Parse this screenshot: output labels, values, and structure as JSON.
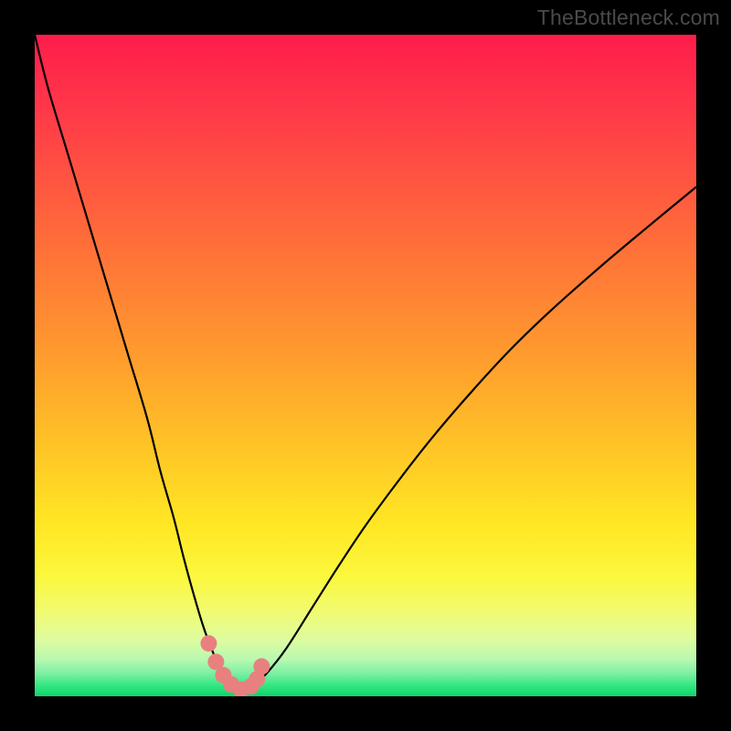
{
  "watermark": {
    "text": "TheBottleneck.com"
  },
  "colors": {
    "frame": "#000000",
    "curve": "#000000",
    "marker_fill": "#e98080",
    "marker_stroke": "#c95a5a",
    "gradient_stops": [
      {
        "offset": 0.0,
        "color": "#ff1c4b"
      },
      {
        "offset": 0.12,
        "color": "#ff3a49"
      },
      {
        "offset": 0.3,
        "color": "#ff6a3a"
      },
      {
        "offset": 0.48,
        "color": "#ff9a2e"
      },
      {
        "offset": 0.62,
        "color": "#ffc326"
      },
      {
        "offset": 0.74,
        "color": "#ffe724"
      },
      {
        "offset": 0.82,
        "color": "#fbf83e"
      },
      {
        "offset": 0.875,
        "color": "#f0fb74"
      },
      {
        "offset": 0.915,
        "color": "#ddfca0"
      },
      {
        "offset": 0.945,
        "color": "#b7f8b0"
      },
      {
        "offset": 0.965,
        "color": "#7ef0a3"
      },
      {
        "offset": 0.985,
        "color": "#2ee67f"
      },
      {
        "offset": 1.0,
        "color": "#0fd46a"
      }
    ]
  },
  "chart_data": {
    "type": "line",
    "title": "",
    "xlabel": "",
    "ylabel": "",
    "xlim": [
      0,
      100
    ],
    "ylim": [
      0,
      100
    ],
    "series": [
      {
        "name": "bottleneck-curve",
        "x": [
          0,
          2,
          5,
          8,
          11,
          14,
          17,
          19,
          21,
          22.5,
          24,
          25.5,
          27,
          28,
          29,
          30,
          31.5,
          33,
          35,
          38,
          42,
          46,
          50,
          55,
          60,
          66,
          72,
          78,
          85,
          92,
          100
        ],
        "y": [
          100,
          92,
          82,
          72,
          62,
          52,
          42,
          34,
          27,
          21,
          15.5,
          10.5,
          6.5,
          4.2,
          2.6,
          1.6,
          1.0,
          1.6,
          3.4,
          7.2,
          13.5,
          19.8,
          25.8,
          32.6,
          39.0,
          46.0,
          52.5,
          58.3,
          64.5,
          70.4,
          77.0
        ]
      }
    ],
    "markers": {
      "name": "highlight-points",
      "x": [
        26.3,
        27.4,
        28.5,
        29.7,
        31.2,
        32.7,
        33.6,
        34.3
      ],
      "y": [
        8.0,
        5.2,
        3.2,
        1.8,
        1.0,
        1.5,
        2.6,
        4.5
      ]
    }
  }
}
